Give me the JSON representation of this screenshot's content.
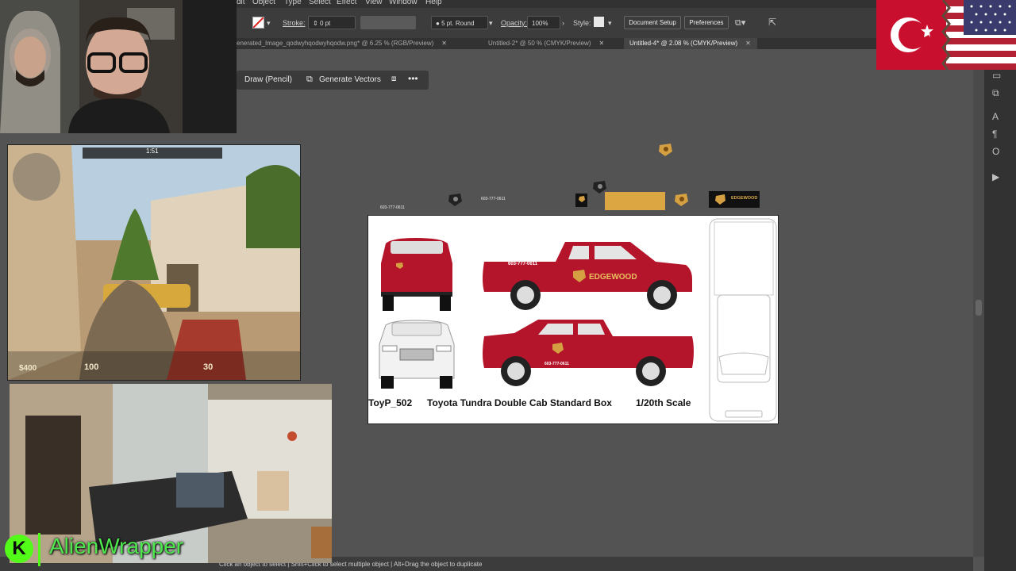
{
  "menu": [
    "dit",
    "Object",
    "Type",
    "Select",
    "Effect",
    "View",
    "Window",
    "Help"
  ],
  "control_bar": {
    "stroke_label": "Stroke:",
    "stroke_value": "0 pt",
    "brush_value": "5 pt. Round",
    "opacity_label": "Opacity:",
    "opacity_value": "100%",
    "style_label": "Style:",
    "doc_setup_label": "Document Setup",
    "preferences_label": "Preferences"
  },
  "tabs": [
    {
      "label": "enerated_Image_qodwyhqodwyhqodw.png* @ 6.25 % (RGB/Preview)",
      "active": false
    },
    {
      "label": "Untitled-2* @ 50 % (CMYK/Preview)",
      "active": false
    },
    {
      "label": "Untitled-4* @ 2.08 % (CMYK/Preview)",
      "active": true
    }
  ],
  "context_bar": {
    "draw_label": "Draw (Pencil)",
    "generate_label": "Generate Vectors"
  },
  "artboard": {
    "caption_code": "ToyP_502",
    "caption_model": "Toyota Tundra Double Cab Standard Box",
    "caption_scale": "1/20th Scale",
    "brand_text": "EDGEWOOD",
    "phone_text": "603-777-0611"
  },
  "canvas_items": {
    "plate_text": "EDGEWOOD",
    "phone_small": "603-777-0611"
  },
  "status_bar": {
    "hint": "Click an object to select | Shift+Click to select multiple object | Alt+Drag the object to duplicate"
  },
  "game_hud": {
    "money": "$400",
    "health": "100",
    "ammo": "30",
    "timer": "1:51"
  },
  "stream": {
    "brand_name": "AlienWrapper",
    "brand_initial": "K"
  },
  "colors": {
    "truck_red": "#b5152b",
    "gold": "#dca742",
    "ui_dark": "#3c3c3c",
    "workspace": "#535353",
    "brand_green": "#4ee84e"
  }
}
